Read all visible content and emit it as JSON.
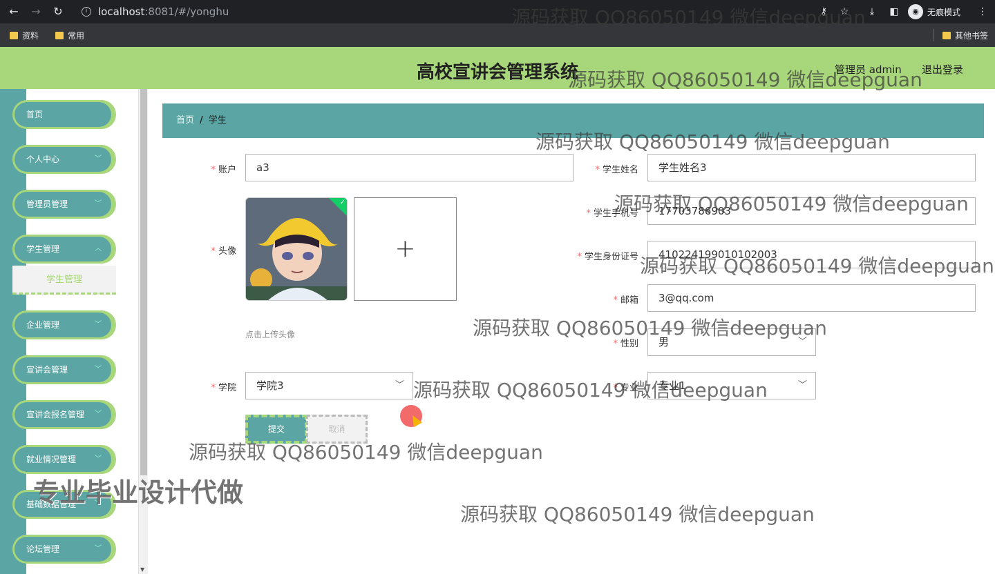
{
  "browser": {
    "url_host": "localhost",
    "url_rest": ":8081/#/yonghu",
    "incognito_label": "无痕模式",
    "bookmarks": [
      "资料",
      "常用"
    ],
    "other_bookmarks": "其他书签"
  },
  "header": {
    "title": "高校宣讲会管理系统",
    "admin_label": "管理员 admin",
    "logout": "退出登录"
  },
  "sidebar": {
    "items": [
      {
        "label": "首页"
      },
      {
        "label": "个人中心"
      },
      {
        "label": "管理员管理"
      },
      {
        "label": "学生管理"
      },
      {
        "label": "企业管理"
      },
      {
        "label": "宣讲会管理"
      },
      {
        "label": "宣讲会报名管理"
      },
      {
        "label": "就业情况管理"
      },
      {
        "label": "基础数据管理"
      },
      {
        "label": "论坛管理"
      }
    ],
    "active_sub": "学生管理"
  },
  "breadcrumb": {
    "home": "首页",
    "separator": "/",
    "current": "学生"
  },
  "form": {
    "account": {
      "label": "账户",
      "value": "a3"
    },
    "avatar": {
      "label": "头像",
      "tip": "点击上传头像"
    },
    "college": {
      "label": "学院",
      "value": "学院3"
    },
    "name": {
      "label": "学生姓名",
      "value": "学生姓名3"
    },
    "phone": {
      "label": "学生手机号",
      "value": "17703786903"
    },
    "id_card": {
      "label": "学生身份证号",
      "value": "410224199010102003"
    },
    "email": {
      "label": "邮箱",
      "value": "3@qq.com"
    },
    "gender": {
      "label": "性别",
      "value": "男"
    },
    "major": {
      "label": "专业",
      "value": "专业1"
    },
    "required_mark": "*",
    "submit": "提交",
    "cancel": "取消"
  },
  "watermarks": {
    "text": "源码获取 QQ86050149 微信deepguan",
    "big_text": "专业毕业设计代做"
  },
  "colors": {
    "header_green": "#a8d67a",
    "teal": "#5ba6a4",
    "required_red": "#f56c6c"
  }
}
